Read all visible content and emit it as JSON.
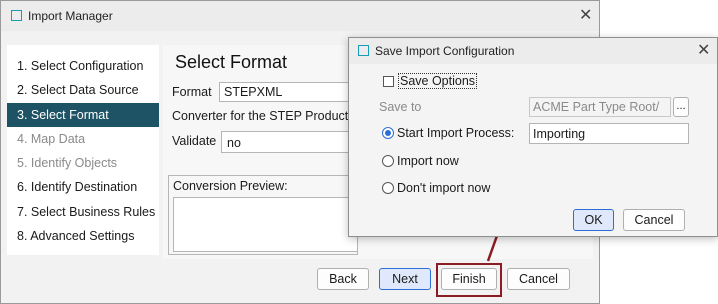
{
  "main_window": {
    "title": "Import Manager",
    "close_glyph": "✕",
    "steps": [
      {
        "label": "1. Select Configuration",
        "state": "normal"
      },
      {
        "label": "2. Select Data Source",
        "state": "normal"
      },
      {
        "label": "3. Select Format",
        "state": "active"
      },
      {
        "label": "4. Map Data",
        "state": "disabled"
      },
      {
        "label": "5. Identify Objects",
        "state": "disabled"
      },
      {
        "label": "6. Identify Destination",
        "state": "normal"
      },
      {
        "label": "7. Select Business Rules",
        "state": "normal"
      },
      {
        "label": "8. Advanced Settings",
        "state": "normal"
      }
    ],
    "heading": "Select Format",
    "format_label": "Format",
    "format_value": "STEPXML",
    "converter_text": "Converter for the STEP Product",
    "validate_label": "Validate",
    "validate_value": "no",
    "conversion_preview_label": "Conversion Preview:",
    "buttons": {
      "back": "Back",
      "next": "Next",
      "finish": "Finish",
      "cancel": "Cancel"
    }
  },
  "dialog": {
    "title": "Save Import Configuration",
    "close_glyph": "✕",
    "save_options_label": "Save Options",
    "save_options_checked": false,
    "save_to_label": "Save to",
    "save_to_value": "ACME Part Type Root/",
    "browse_label": "...",
    "start_import_label": "Start Import Process:",
    "start_import_value": "Importing",
    "import_now_label": "Import now",
    "dont_import_label": "Don't import now",
    "selected_option": "Start Import Process:",
    "ok_label": "OK",
    "cancel_label": "Cancel"
  },
  "colors": {
    "active_step_bg": "#1e5366",
    "accent": "#2b6fd6",
    "callout": "#8b1c24",
    "app_icon": "#1a9bb5"
  },
  "icons": [
    "app-icon",
    "close-icon",
    "checkbox-icon",
    "radio-icon",
    "callout-arrow-icon"
  ]
}
